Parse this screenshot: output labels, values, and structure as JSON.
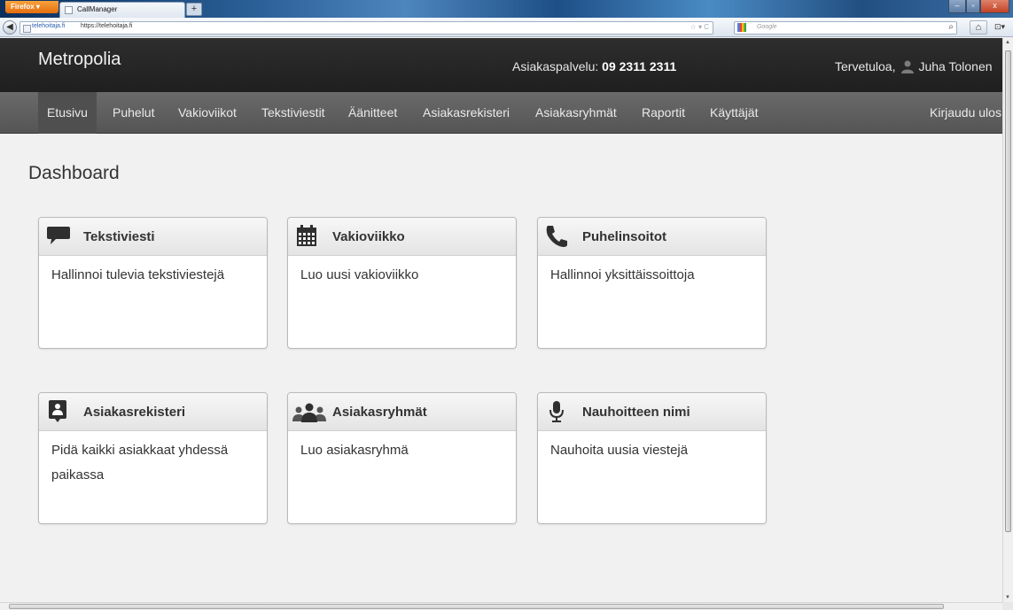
{
  "browser": {
    "menu_label": "Firefox ▾",
    "tab_title": "CallManager",
    "new_tab": "+",
    "url_identity": "telehoitaja.fi",
    "url": "https://telehoitaja.fi",
    "url_icons": "☆ ▾ C",
    "search_placeholder": "Google",
    "search_go": "⌕",
    "home": "⌂",
    "menu": "⊡▾",
    "back": "◀",
    "min": "–",
    "max": "▫",
    "close": "x"
  },
  "header": {
    "brand": "Metropolia",
    "service_label": "Asiakaspalvelu:",
    "service_phone": "09 2311 2311",
    "greeting": "Tervetuloa,",
    "user_name": "Juha Tolonen"
  },
  "nav": {
    "items": [
      "Etusivu",
      "Puhelut",
      "Vakioviikot",
      "Tekstiviestit",
      "Äänitteet",
      "Asiakasrekisteri",
      "Asiakasryhmät",
      "Raportit",
      "Käyttäjät"
    ],
    "logout": "Kirjaudu ulos"
  },
  "page": {
    "title": "Dashboard"
  },
  "cards": [
    {
      "title": "Tekstiviesti",
      "icon": "speech-bubble-icon",
      "text": "Hallinnoi tulevia tekstiviestejä"
    },
    {
      "title": "Vakioviikko",
      "icon": "calendar-icon",
      "text": "Luo uusi vakioviikko"
    },
    {
      "title": "Puhelinsoitot",
      "icon": "phone-icon",
      "text": "Hallinnoi yksittäissoittoja"
    },
    {
      "title": "Asiakasrekisteri",
      "icon": "contact-card-icon",
      "text": "Pidä kaikki asiakkaat yhdessä paikassa"
    },
    {
      "title": "Asiakasryhmät",
      "icon": "group-icon",
      "text": "Luo asiakasryhmä"
    },
    {
      "title": "Nauhoitteen nimi",
      "icon": "microphone-icon",
      "text": "Nauhoita uusia viestejä"
    }
  ],
  "colors": {
    "header_bg": "#262626",
    "nav_bg": "#5e5e5e",
    "page_bg": "#f1f1f1",
    "card_border": "#b9b9b9",
    "icon": "#333333"
  }
}
